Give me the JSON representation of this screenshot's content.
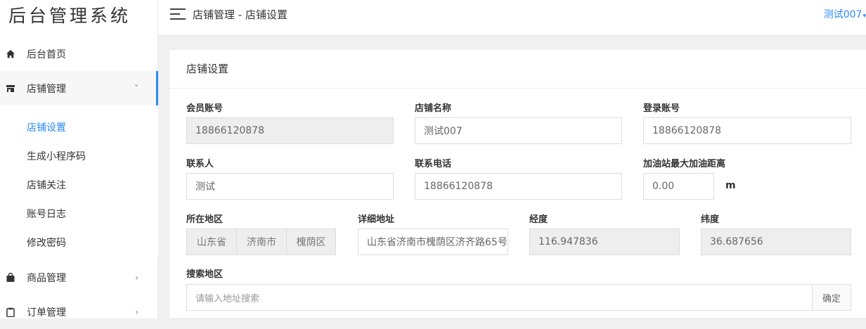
{
  "app": {
    "logo_text": "后台管理系统"
  },
  "header": {
    "breadcrumb": "店铺管理 - 店铺设置",
    "user_name": "测试007",
    "caret": "▾"
  },
  "sidebar": {
    "items": [
      {
        "label": "后台首页",
        "icon": "home-icon"
      },
      {
        "label": "店铺管理",
        "icon": "store-icon",
        "arrow": "˅"
      },
      {
        "label": "商品管理",
        "icon": "bag-icon",
        "arrow": "›"
      },
      {
        "label": "订单管理",
        "icon": "clipboard-icon",
        "arrow": "›"
      }
    ],
    "submenu": [
      "店铺设置",
      "生成小程序码",
      "店铺关注",
      "账号日志",
      "修改密码"
    ],
    "accent": "#2a8af7"
  },
  "card": {
    "title": "店铺设置",
    "fields": {
      "member_account": {
        "label": "会员账号",
        "value": "18866120878"
      },
      "store_name": {
        "label": "店铺名称",
        "value": "测试007"
      },
      "login_account": {
        "label": "登录账号",
        "value": "18866120878"
      },
      "contact": {
        "label": "联系人",
        "value": "测试"
      },
      "phone": {
        "label": "联系电话",
        "value": "18866120878"
      },
      "max_distance": {
        "label": "加油站最大加油距离",
        "value": "0.00",
        "unit": "m"
      },
      "region": {
        "label": "所在地区",
        "province": "山东省",
        "city": "济南市",
        "district": "槐荫区"
      },
      "address": {
        "label": "详细地址",
        "value": "山东省济南市槐荫区济齐路65号"
      },
      "longitude": {
        "label": "经度",
        "value": "116.947836"
      },
      "latitude": {
        "label": "纬度",
        "value": "36.687656"
      },
      "search": {
        "label": "搜索地区",
        "placeholder": "请输入地址搜索",
        "button": "确定"
      }
    }
  }
}
